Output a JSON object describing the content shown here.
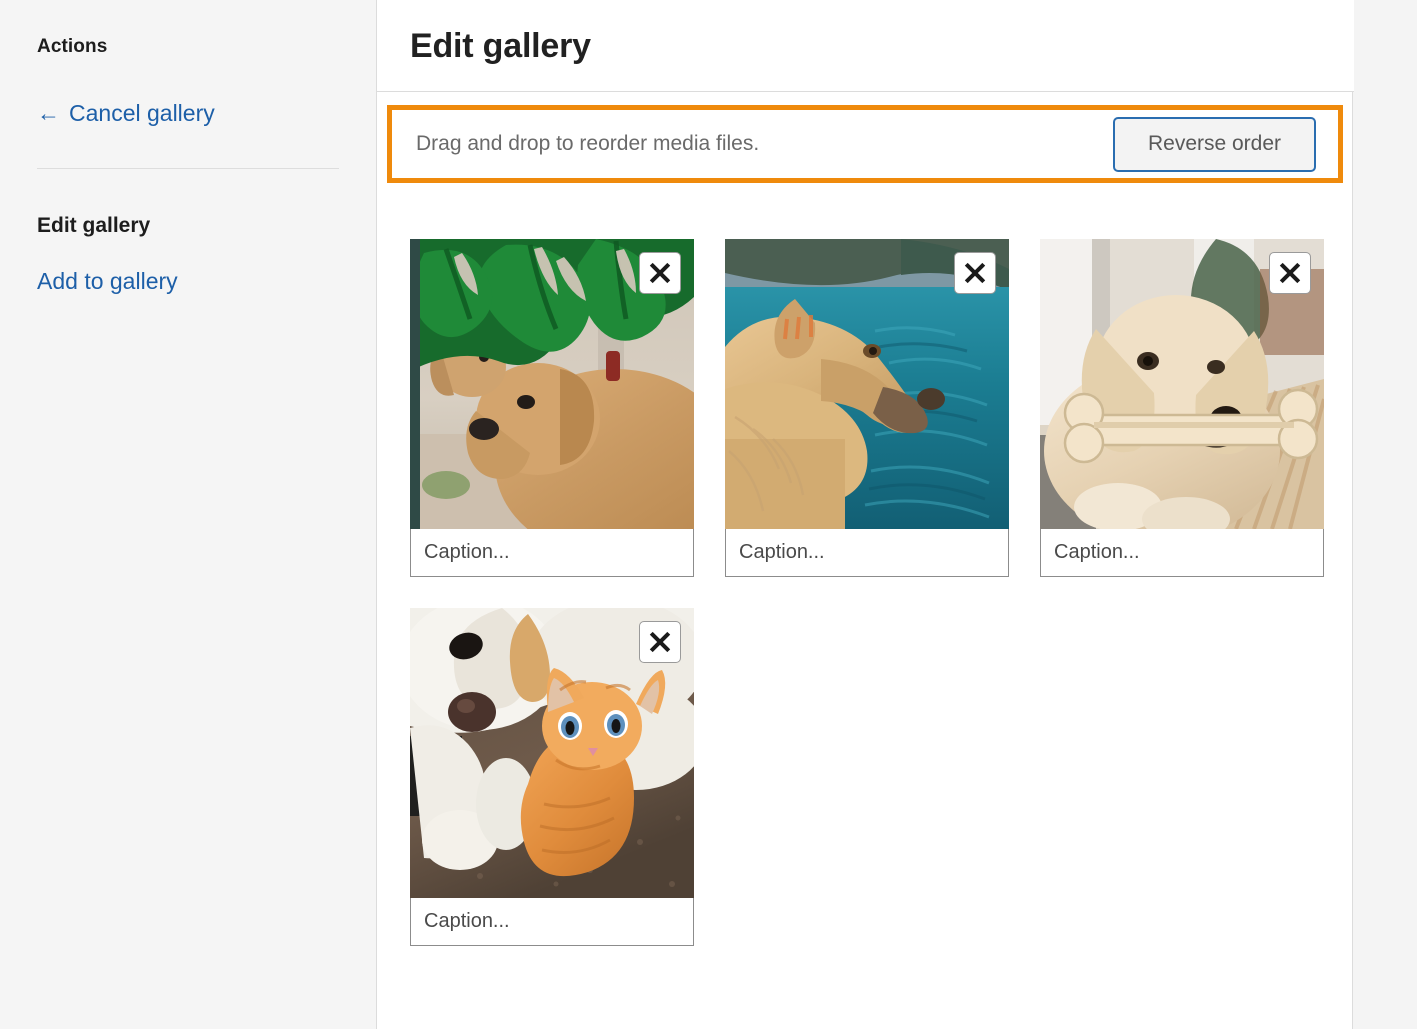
{
  "sidebar": {
    "heading": "Actions",
    "cancel_gallery": {
      "arrow": "←",
      "label": "Cancel gallery"
    },
    "section_label": "Edit gallery",
    "add_to_gallery": {
      "label": "Add to gallery"
    }
  },
  "header": {
    "title": "Edit gallery"
  },
  "notice": {
    "text": "Drag and drop to reorder media files.",
    "reverse_order_label": "Reverse order",
    "highlight_color": "#ef8a0c",
    "button_border_color": "#2a6db0"
  },
  "gallery": {
    "remove_icon": "close-x-icon",
    "items": [
      {
        "alt": "Golden retriever dog resting under large green monstera leaves on a patio",
        "caption_value": "",
        "caption_placeholder": "Caption...",
        "remove_label": "Remove media file"
      },
      {
        "alt": "Golden retriever in profile in front of teal blue water",
        "caption_value": "",
        "caption_placeholder": "Caption...",
        "remove_label": "Remove media file"
      },
      {
        "alt": "Cream golden retriever lying down holding a bone shaped chew toy",
        "caption_value": "",
        "caption_placeholder": "Caption...",
        "remove_label": "Remove media file"
      },
      {
        "alt": "White curly haired dog lying next to an orange tabby kitten on brown carpet",
        "caption_value": "",
        "caption_placeholder": "Caption...",
        "remove_label": "Remove media file"
      }
    ]
  },
  "colors": {
    "link": "#1d5fa8",
    "sidebar_bg": "#f5f5f5",
    "panel_bg": "#ffffff",
    "rail_bg": "#f4f4f4",
    "text_dark": "#1d1d1d",
    "text_muted": "#6a6a6a"
  }
}
